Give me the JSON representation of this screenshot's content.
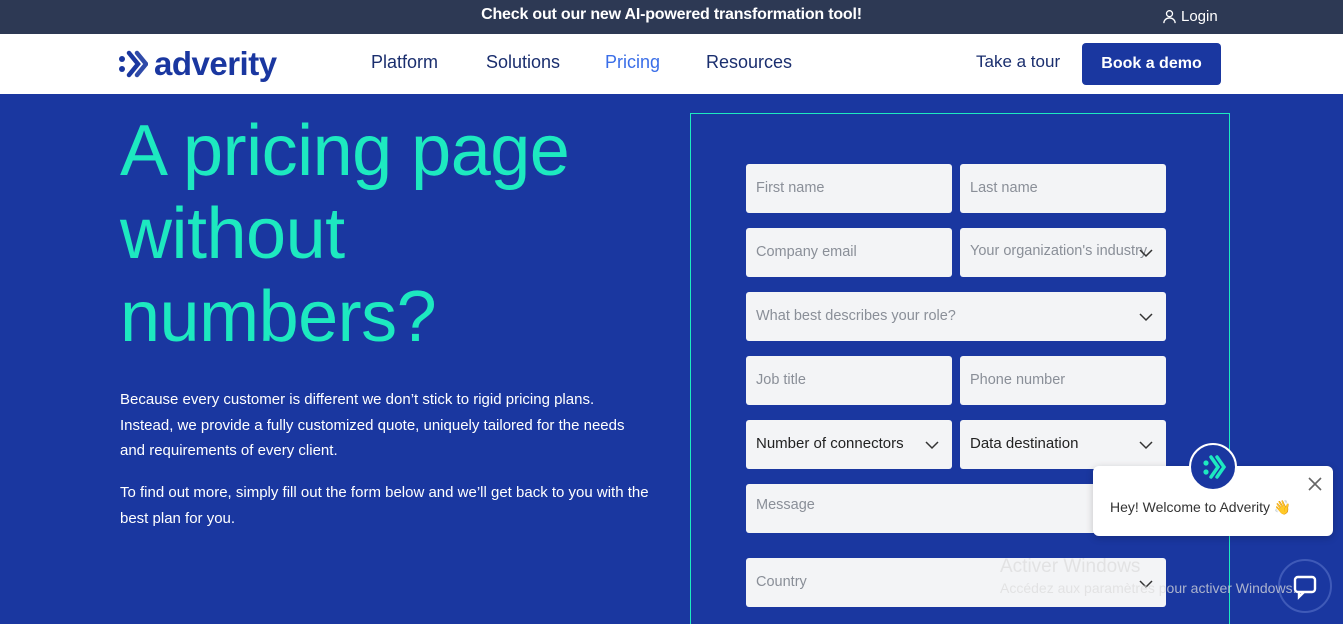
{
  "promo": {
    "text": "Check out our new AI-powered transformation tool!",
    "login": "Login"
  },
  "nav": {
    "logo": "adverity",
    "items": [
      {
        "label": "Platform"
      },
      {
        "label": "Solutions"
      },
      {
        "label": "Pricing"
      },
      {
        "label": "Resources"
      }
    ],
    "active": "Pricing",
    "tour": "Take a tour",
    "demo": "Book a demo"
  },
  "hero": {
    "title_lines": [
      "A pricing page",
      "without",
      "numbers?"
    ],
    "para1": "Because every customer is different we don’t stick to rigid pricing plans. Instead, we provide a fully customized quote, uniquely tailored for the needs and requirements of every client.",
    "para2": "To find out more, simply fill out the form below and we’ll get back to you with the best plan for you."
  },
  "form": {
    "first_name": "First name",
    "last_name": "Last name",
    "company_email": "Company email",
    "industry": "Your organization's industry",
    "role": "What best describes your role?",
    "job_title": "Job title",
    "phone": "Phone number",
    "connectors": "Number of connectors",
    "destination": "Data destination",
    "message": "Message",
    "country": "Country"
  },
  "chat": {
    "message": "Hey! Welcome to Adverity 👋"
  },
  "watermark": {
    "title": "Activer Windows",
    "subtitle": "Accédez aux paramètres pour activer Windows."
  },
  "colors": {
    "brand": "#1a37a0",
    "accent": "#1de9c0",
    "promo_bg": "#2d3954",
    "nav_active": "#3a6ee8"
  }
}
